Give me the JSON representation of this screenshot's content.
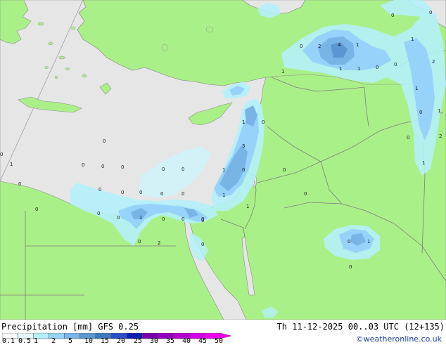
{
  "title": {
    "left": "Precipitation [mm]  GFS 0.25",
    "right": "Th 11-12-2025 00..03 UTC (12+135)"
  },
  "copyright": "©weatheronline.co.uk",
  "colors": {
    "land": "#aaf088",
    "sea": "#e6e6e6",
    "border": "#7d7d7d",
    "precip_light": "#b4f0fa",
    "precip_mid": "#96d2fa",
    "precip_heavy": "#78b4e6",
    "precip_core": "#5a96d2"
  },
  "legend": {
    "labels": [
      "0.1",
      "0.5",
      "1",
      "2",
      "5",
      "10",
      "15",
      "20",
      "25",
      "30",
      "35",
      "40",
      "45",
      "50"
    ],
    "colors": [
      "#fafafa",
      "#e6f8fc",
      "#b4f0fa",
      "#96d2fa",
      "#78b4e6",
      "#5a96d2",
      "#3c78be",
      "#2850c8",
      "#0a1eb4",
      "#7800aa",
      "#9600be",
      "#b400d2",
      "#d200e6",
      "#f000f0"
    ]
  },
  "map_labels": [
    {
      "text": "0"
    },
    {
      "text": "0"
    },
    {
      "text": "0"
    },
    {
      "text": "0"
    },
    {
      "text": "0"
    },
    {
      "text": "2"
    },
    {
      "text": "4"
    },
    {
      "text": "1"
    },
    {
      "text": "1"
    },
    {
      "text": "1"
    },
    {
      "text": "0"
    },
    {
      "text": "0"
    },
    {
      "text": "1"
    },
    {
      "text": "0"
    },
    {
      "text": "1"
    },
    {
      "text": "2"
    },
    {
      "text": "1"
    },
    {
      "text": "0"
    },
    {
      "text": "1"
    },
    {
      "text": "2"
    },
    {
      "text": "0"
    },
    {
      "text": "1"
    },
    {
      "text": "1"
    },
    {
      "text": "0"
    },
    {
      "text": "3"
    },
    {
      "text": "0"
    },
    {
      "text": "1"
    },
    {
      "text": "0"
    },
    {
      "text": "0"
    },
    {
      "text": "0"
    },
    {
      "text": "1"
    },
    {
      "text": "1"
    },
    {
      "text": "0"
    },
    {
      "text": "0"
    },
    {
      "text": "0"
    },
    {
      "text": "0"
    },
    {
      "text": "0"
    },
    {
      "text": "0"
    },
    {
      "text": "0"
    },
    {
      "text": "1"
    },
    {
      "text": "0"
    },
    {
      "text": "0"
    },
    {
      "text": "0"
    },
    {
      "text": "0"
    },
    {
      "text": "2"
    },
    {
      "text": "0"
    },
    {
      "text": "0"
    },
    {
      "text": "1"
    },
    {
      "text": "0"
    },
    {
      "text": "0"
    },
    {
      "text": "0"
    },
    {
      "text": "0"
    },
    {
      "text": "1"
    },
    {
      "text": "0"
    },
    {
      "text": "0"
    },
    {
      "text": "0"
    }
  ]
}
